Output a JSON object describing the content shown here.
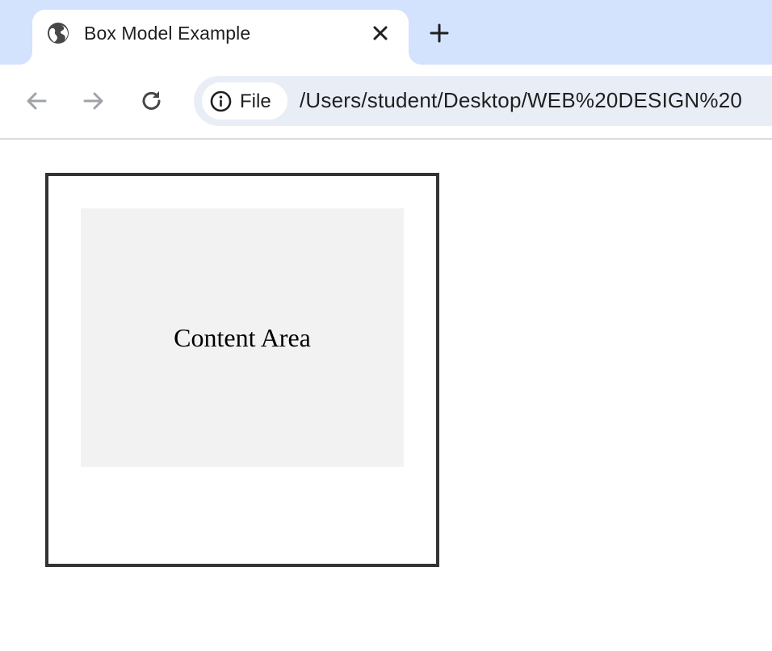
{
  "browser": {
    "tab": {
      "title": "Box Model Example",
      "icon": "globe-icon",
      "close_icon": "close-icon"
    },
    "new_tab_icon": "plus-icon",
    "toolbar": {
      "back_icon": "arrow-left-icon",
      "forward_icon": "arrow-right-icon",
      "reload_icon": "reload-icon",
      "site_info": {
        "icon": "info-icon",
        "label": "File"
      },
      "url": "/Users/student/Desktop/WEB%20DESIGN%20"
    },
    "colors": {
      "tabstrip": "#d3e3fd",
      "omnibox": "#e9eef6",
      "disabled_icon": "#a0a4a8",
      "icon": "#474747"
    }
  },
  "page": {
    "content_area_label": "Content Area",
    "colors": {
      "box_border": "#333333",
      "content_background": "#f2f2f2"
    }
  }
}
